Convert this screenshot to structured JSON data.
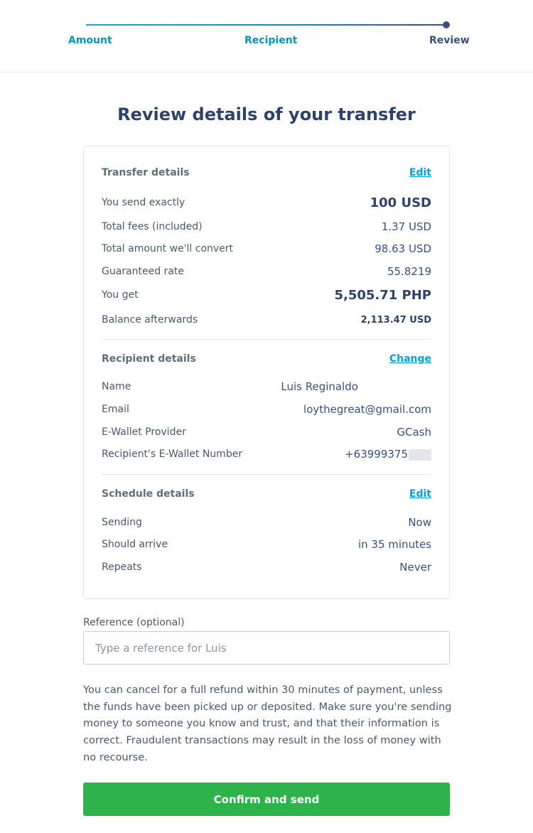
{
  "stepper": {
    "steps": [
      {
        "label": "Amount"
      },
      {
        "label": "Recipient"
      },
      {
        "label": "Review"
      }
    ],
    "active_index": 2
  },
  "page_title": "Review details of your transfer",
  "transfer_details": {
    "title": "Transfer details",
    "edit_label": "Edit",
    "rows": [
      {
        "label": "You send exactly",
        "value": "100 USD"
      },
      {
        "label": "Total fees (included)",
        "value": "1.37 USD"
      },
      {
        "label": "Total amount we'll convert",
        "value": "98.63 USD"
      },
      {
        "label": "Guaranteed rate",
        "value": "55.8219"
      },
      {
        "label": "You get",
        "value": "5,505.71 PHP"
      },
      {
        "label": "Balance afterwards",
        "value": "2,113.47 USD"
      }
    ]
  },
  "recipient_details": {
    "title": "Recipient details",
    "change_label": "Change",
    "rows": [
      {
        "label": "Name",
        "value": "Luis Reginaldo"
      },
      {
        "label": "Email",
        "value": "loythegreat@gmail.com"
      },
      {
        "label": "E-Wallet Provider",
        "value": "GCash"
      },
      {
        "label": "Recipient's E-Wallet Number",
        "value": "+63999375"
      }
    ]
  },
  "schedule_details": {
    "title": "Schedule details",
    "edit_label": "Edit",
    "rows": [
      {
        "label": "Sending",
        "value": "Now"
      },
      {
        "label": "Should arrive",
        "value": "in 35 minutes"
      },
      {
        "label": "Repeats",
        "value": "Never"
      }
    ]
  },
  "reference": {
    "label": "Reference (optional)",
    "placeholder": "Type a reference for Luis",
    "value": ""
  },
  "disclaimer": "You can cancel for a full refund within 30 minutes of payment, unless the funds have been picked up or deposited. Make sure you're sending money to someone you know and trust, and that their information is correct. Fraudulent transactions may result in the loss of money with no recourse.",
  "confirm_label": "Confirm and send",
  "colors": {
    "accent": "#00a2dd",
    "primary_text": "#37517e",
    "confirm": "#2db34a"
  }
}
